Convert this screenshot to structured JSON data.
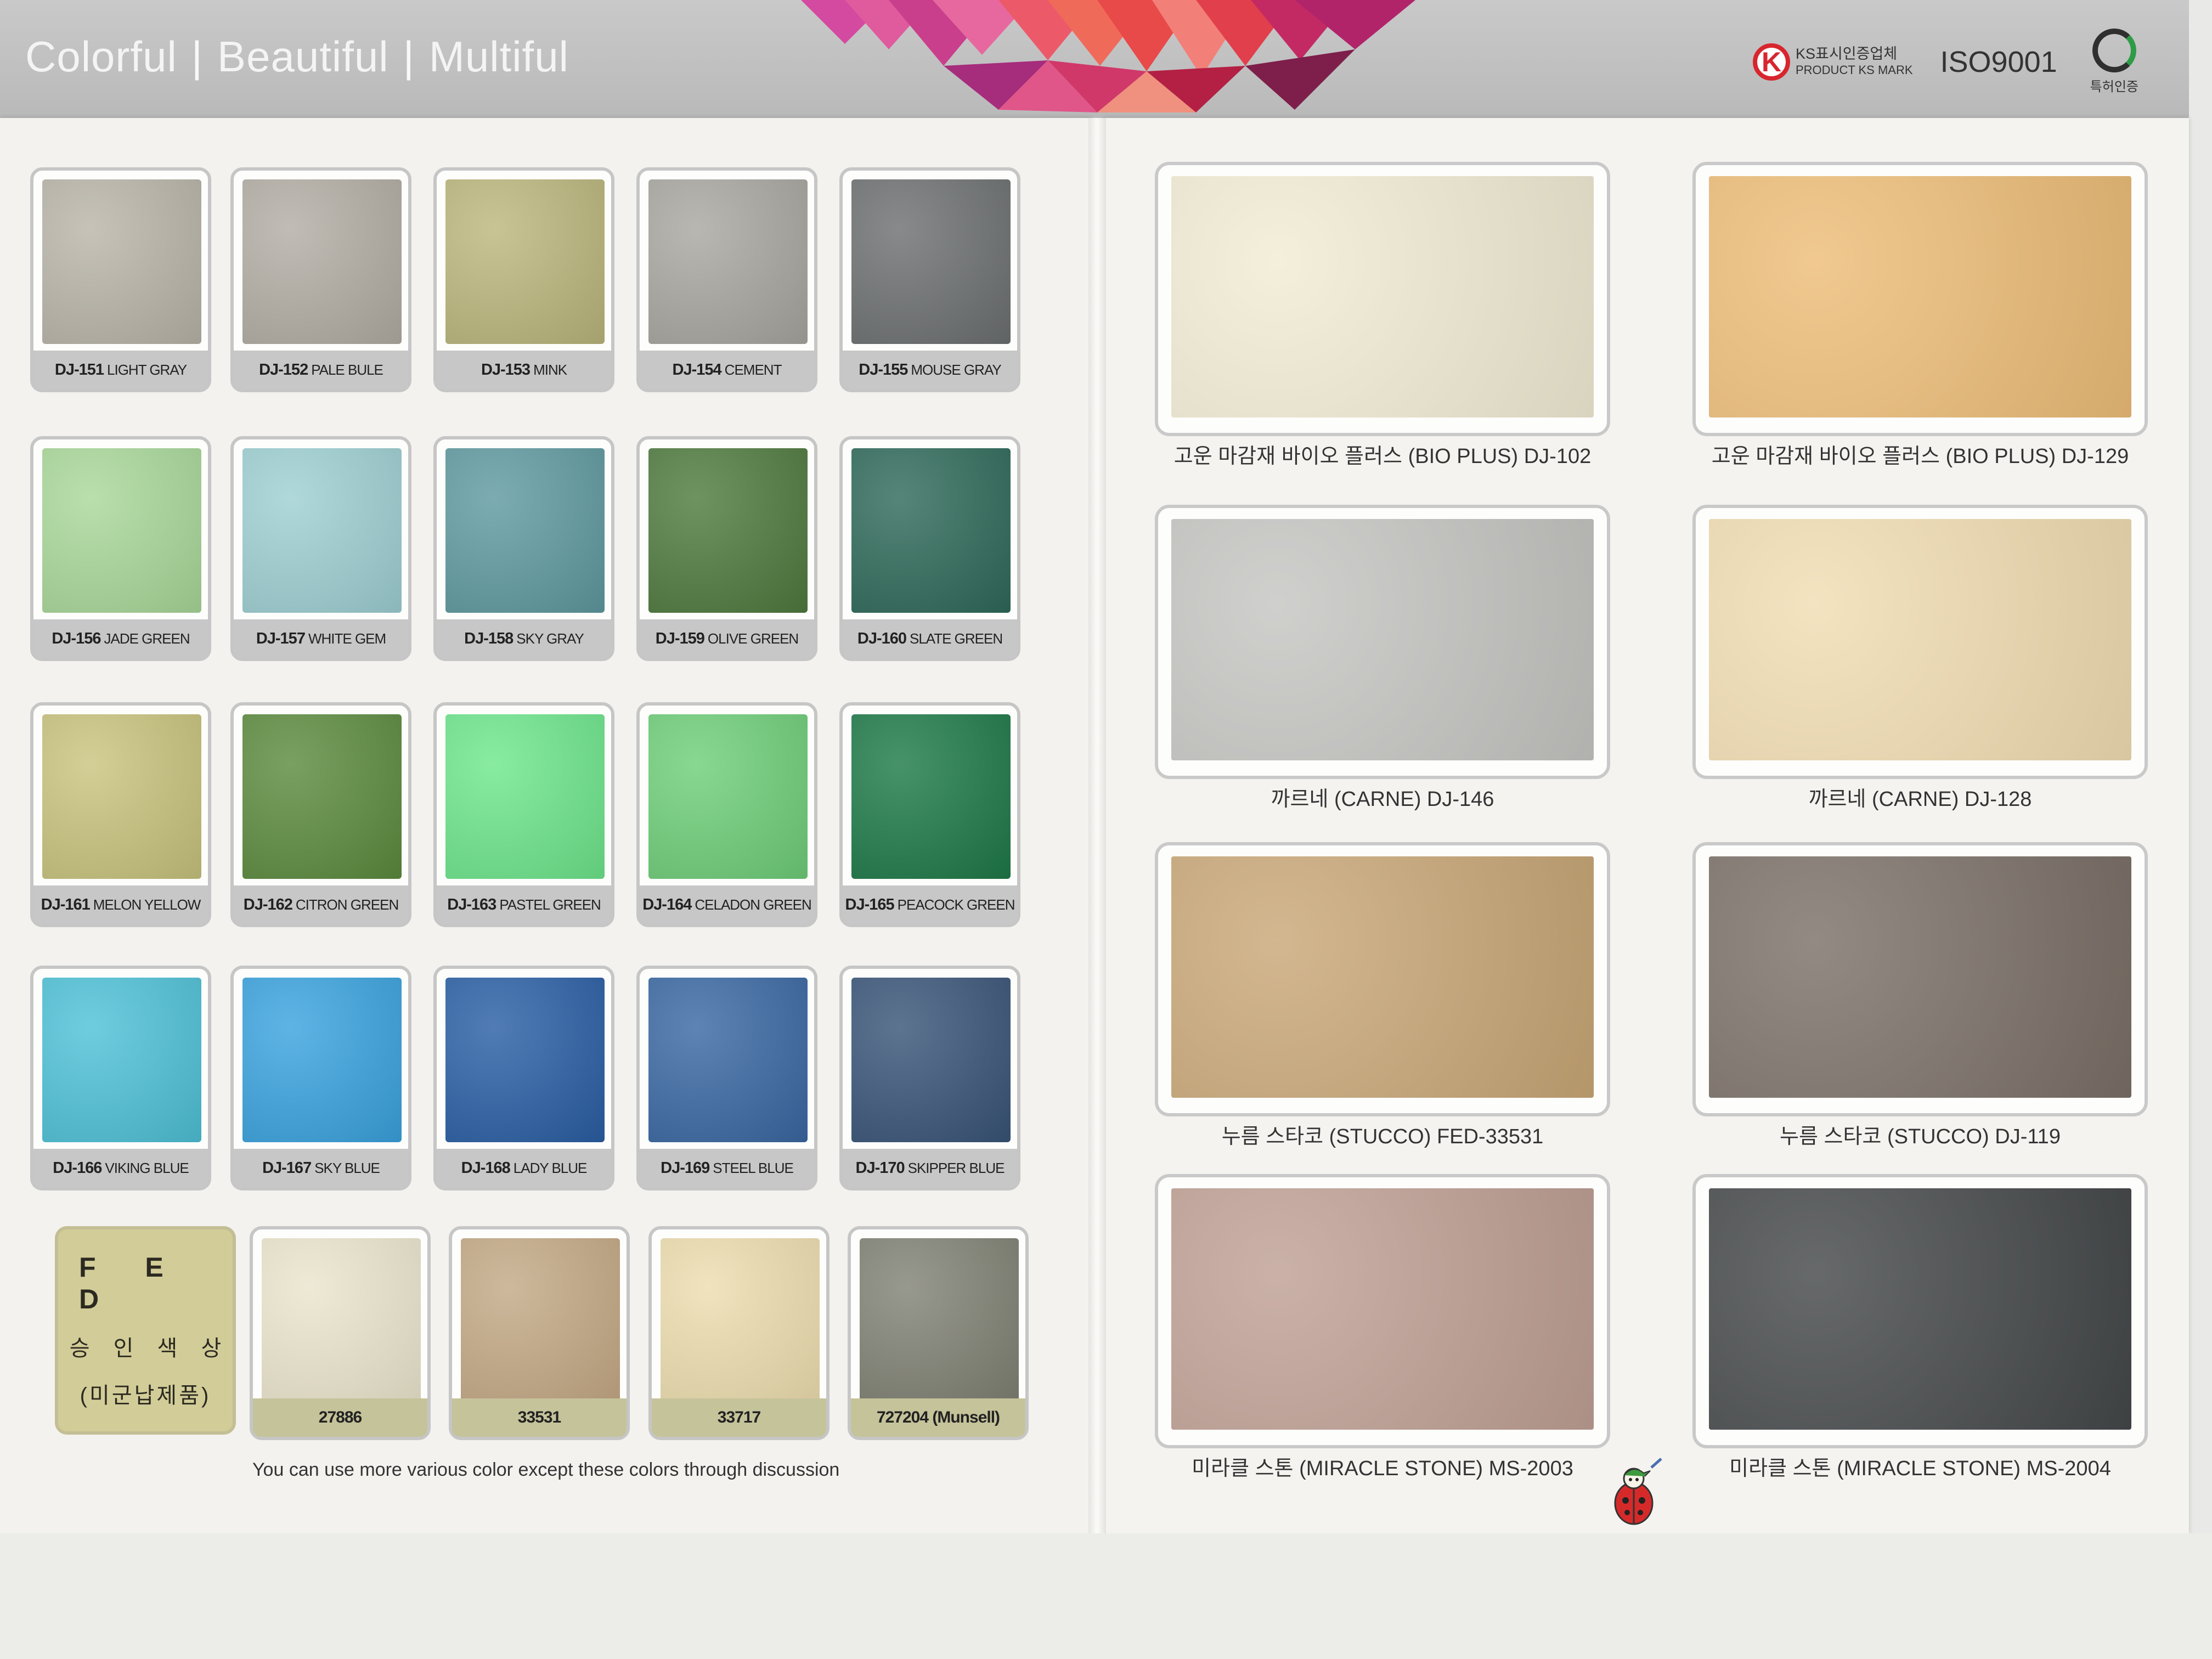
{
  "header": {
    "tagline": [
      "Colorful",
      "Beautiful",
      "Multiful"
    ],
    "separator": "|",
    "ks_mark_line1": "KS표시인증업체",
    "ks_mark_line2": "PRODUCT KS MARK",
    "ks_letter": "K",
    "iso": "ISO9001",
    "patent": "특허인증"
  },
  "left_page": {
    "swatches": [
      {
        "code": "DJ-151",
        "name": "LIGHT GRAY",
        "color": "#b9b5a9"
      },
      {
        "code": "DJ-152",
        "name": "PALE BULE",
        "color": "#b3ada4"
      },
      {
        "code": "DJ-153",
        "name": "MINK",
        "color": "#bcb77d"
      },
      {
        "code": "DJ-154",
        "name": "CEMENT",
        "color": "#a9a7a0"
      },
      {
        "code": "DJ-155",
        "name": "MOUSE GRAY",
        "color": "#6d7071"
      },
      {
        "code": "DJ-156",
        "name": "JADE GREEN",
        "color": "#aad99a"
      },
      {
        "code": "DJ-157",
        "name": "WHITE GEM",
        "color": "#9fd0d3"
      },
      {
        "code": "DJ-158",
        "name": "SKY GRAY",
        "color": "#5f9aa0"
      },
      {
        "code": "DJ-159",
        "name": "OLIVE GREEN",
        "color": "#4f7a3e"
      },
      {
        "code": "DJ-160",
        "name": "SLATE GREEN",
        "color": "#2f6a5a"
      },
      {
        "code": "DJ-161",
        "name": "MELON YELLOW",
        "color": "#c9c47e"
      },
      {
        "code": "DJ-162",
        "name": "CITRON GREEN",
        "color": "#5c8b3e"
      },
      {
        "code": "DJ-163",
        "name": "PASTEL GREEN",
        "color": "#6ee78c"
      },
      {
        "code": "DJ-164",
        "name": "CELADON GREEN",
        "color": "#6fcf79"
      },
      {
        "code": "DJ-165",
        "name": "PEACOCK GREEN",
        "color": "#1e7a48"
      },
      {
        "code": "DJ-166",
        "name": "VIKING BLUE",
        "color": "#4fc2d8"
      },
      {
        "code": "DJ-167",
        "name": "SKY BLUE",
        "color": "#3aa3df"
      },
      {
        "code": "DJ-168",
        "name": "LADY BLUE",
        "color": "#2a5fa5"
      },
      {
        "code": "DJ-169",
        "name": "STEEL BLUE",
        "color": "#3a68a3"
      },
      {
        "code": "DJ-170",
        "name": "SKIPPER BLUE",
        "color": "#395578"
      }
    ],
    "fed_box": {
      "line1": "F E D",
      "line2": "승 인 색 상",
      "line3": "(미군납제품)"
    },
    "fed_swatches": [
      {
        "label": "27886",
        "color": "#eae4cc"
      },
      {
        "label": "33531",
        "color": "#c2a783"
      },
      {
        "label": "33717",
        "color": "#ecdcad"
      },
      {
        "label": "727204 (Munsell)",
        "color": "#7e7f72"
      }
    ],
    "note": "You can use more various color except these colors through discussion"
  },
  "right_page": {
    "panels": [
      {
        "caption": "고운 마감재 바이오 플러스 (BIO PLUS) DJ-102",
        "color": "#f1ecd4"
      },
      {
        "caption": "고운 마감재 바이오 플러스 (BIO PLUS) DJ-129",
        "color": "#edbd78"
      },
      {
        "caption": "까르네 (CARNE) DJ-146",
        "color": "#c5c5c2"
      },
      {
        "caption": "까르네 (CARNE) DJ-128",
        "color": "#f1ddb2"
      },
      {
        "caption": "누름 스타코 (STUCCO) FED-33531",
        "color": "#c9a777"
      },
      {
        "caption": "누름 스타코 (STUCCO) DJ-119",
        "color": "#7b7068"
      },
      {
        "caption": "미라클 스톤 (MIRACLE STONE) MS-2003",
        "color": "#bfa094"
      },
      {
        "caption": "미라클 스톤 (MIRACLE STONE) MS-2004",
        "color": "#45484a"
      }
    ]
  }
}
